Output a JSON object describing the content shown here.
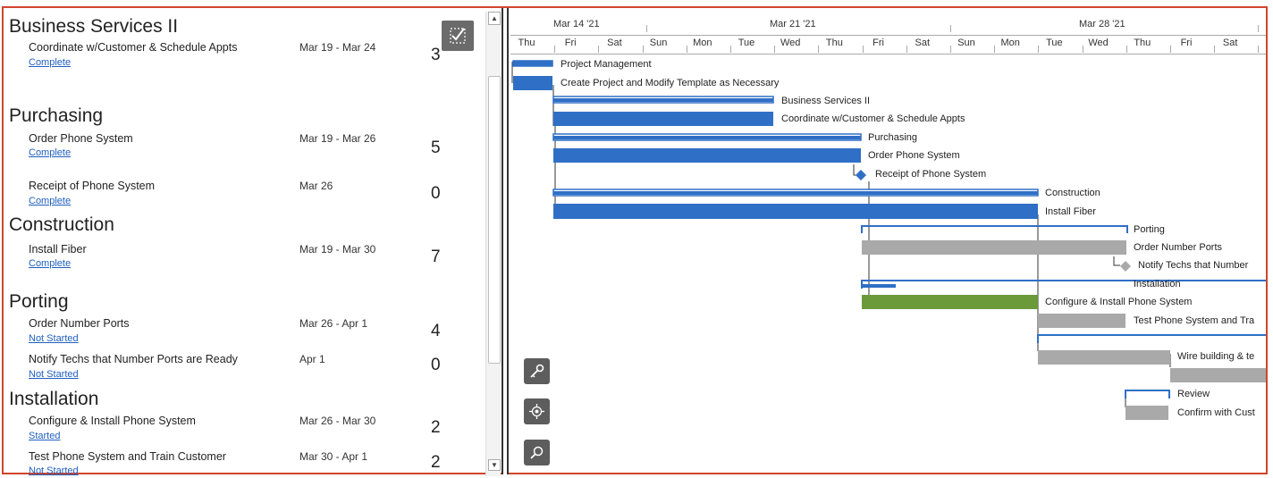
{
  "task_list": {
    "sections": [
      {
        "title": "Business Services II",
        "tasks": [
          {
            "name": "Coordinate w/Customer & Schedule Appts",
            "status": "Complete",
            "dates": "Mar 19 - Mar 24",
            "duration": "3"
          }
        ]
      },
      {
        "title": "Purchasing",
        "tasks": [
          {
            "name": "Order Phone System",
            "status": "Complete",
            "dates": "Mar 19 - Mar 26",
            "duration": "5"
          },
          {
            "name": "Receipt of Phone System",
            "status": "Complete",
            "dates": "Mar 26",
            "duration": "0"
          }
        ]
      },
      {
        "title": "Construction",
        "tasks": [
          {
            "name": "Install Fiber",
            "status": "Complete",
            "dates": "Mar 19 - Mar 30",
            "duration": "7"
          }
        ]
      },
      {
        "title": "Porting",
        "tasks": [
          {
            "name": "Order Number Ports",
            "status": "Not Started",
            "dates": "Mar 26 - Apr 1",
            "duration": "4"
          },
          {
            "name": "Notify Techs that Number Ports are Ready",
            "status": "Not Started",
            "dates": "Apr 1",
            "duration": "0"
          }
        ]
      },
      {
        "title": "Installation",
        "tasks": [
          {
            "name": "Configure & Install Phone System",
            "status": "Started",
            "dates": "Mar 26 - Mar 30",
            "duration": "2"
          },
          {
            "name": "Test Phone System and Train Customer",
            "status": "Not Started",
            "dates": "Mar 30 - Apr 1",
            "duration": "2"
          }
        ]
      }
    ]
  },
  "timeline": {
    "weeks": [
      "Mar 14 '21",
      "Mar 21 '21",
      "Mar 28 '21"
    ],
    "days": [
      "Thu",
      "Fri",
      "Sat",
      "Sun",
      "Mon",
      "Tue",
      "Wed",
      "Thu",
      "Fri",
      "Sat",
      "Sun",
      "Mon",
      "Tue",
      "Wed",
      "Thu",
      "Fri",
      "Sat"
    ]
  },
  "gantt_labels": [
    "Project Management",
    "Create Project and Modify Template as Necessary",
    "Business Services II",
    "Coordinate w/Customer & Schedule Appts",
    "Purchasing",
    "Order Phone System",
    "Receipt of Phone System",
    "Construction",
    "Install Fiber",
    "Porting",
    "Order Number Ports",
    "Notify Techs that Number",
    "Installation",
    "Configure & Install Phone System",
    "Test Phone System and Tra",
    "Wire building & te",
    "Review",
    "Confirm with Cust"
  ],
  "colors": {
    "blue": "#2f6fc6",
    "gray": "#a9a9a9",
    "green": "#6a9a3a",
    "frame": "#d2442a"
  },
  "icons": {
    "check_button": "checklist-icon",
    "tool1": "key-icon",
    "tool2": "locate-icon",
    "tool3": "zoom-icon"
  }
}
